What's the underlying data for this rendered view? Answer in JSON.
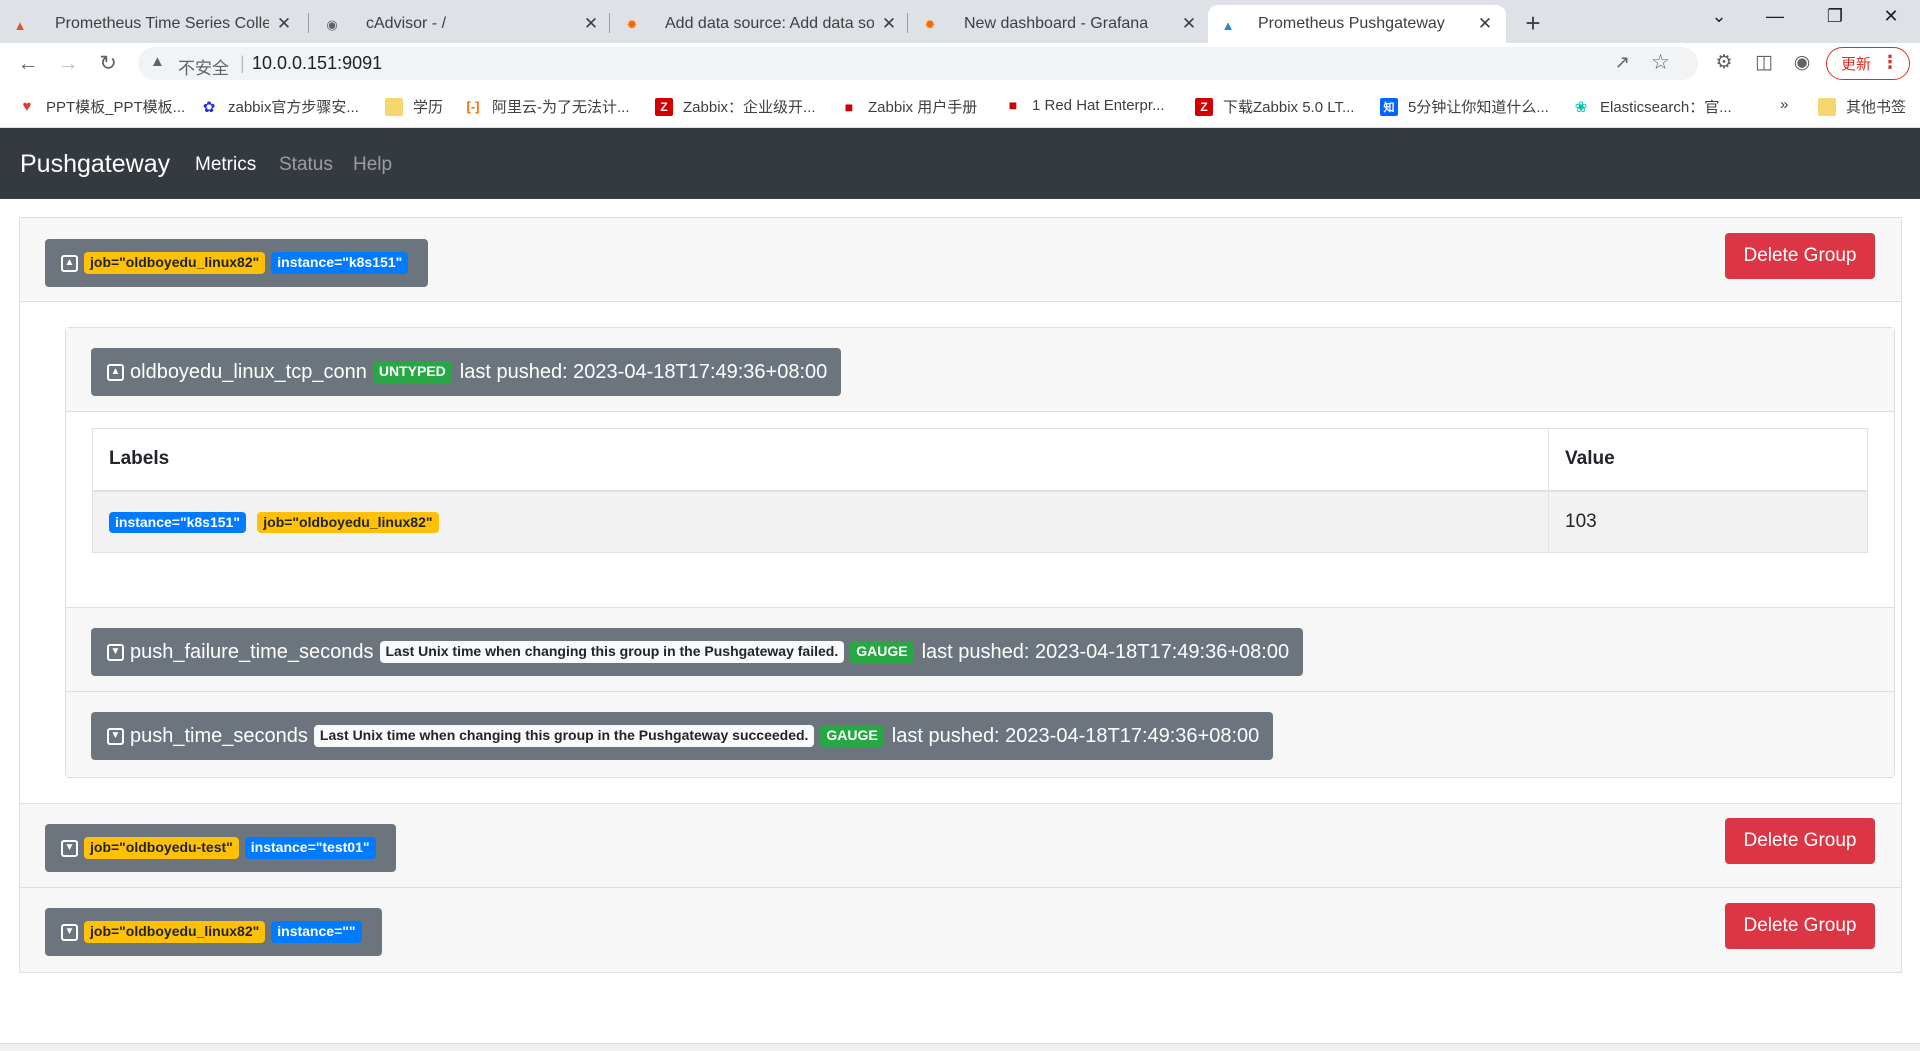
{
  "browser": {
    "tabs": [
      {
        "title": "Prometheus Time Series Collec"
      },
      {
        "title": "cAdvisor - /"
      },
      {
        "title": "Add data source: Add data so"
      },
      {
        "title": "New dashboard - Grafana"
      },
      {
        "title": "Prometheus Pushgateway"
      }
    ],
    "address": {
      "insecure_label": "不安全",
      "url": "10.0.0.151:9091"
    },
    "update_label": "更新",
    "bookmarks": [
      {
        "label": "PPT模板_PPT模板..."
      },
      {
        "label": "zabbix官方步骤安..."
      },
      {
        "label": "学历"
      },
      {
        "label": "阿里云-为了无法计..."
      },
      {
        "label": "Zabbix：企业级开..."
      },
      {
        "label": "Zabbix 用户手册"
      },
      {
        "label": "1 Red Hat Enterpr..."
      },
      {
        "label": "下载Zabbix 5.0 LT..."
      },
      {
        "label": "5分钟让你知道什么..."
      },
      {
        "label": "Elasticsearch：官..."
      }
    ],
    "other_bookmarks": "其他书签",
    "more_bookmarks": "»"
  },
  "navbar": {
    "brand": "Pushgateway",
    "links": [
      {
        "label": "Metrics"
      },
      {
        "label": "Status"
      },
      {
        "label": "Help"
      }
    ]
  },
  "groups": [
    {
      "labels": [
        {
          "text": "job=\"oldboyedu_linux82\""
        },
        {
          "text": "instance=\"k8s151\""
        }
      ],
      "delete_label": "Delete Group",
      "metrics": [
        {
          "name": "oldboyedu_linux_tcp_conn",
          "type": "UNTYPED",
          "last_pushed": "last pushed: 2023-04-18T17:49:36+08:00",
          "table": {
            "headers": {
              "labels": "Labels",
              "value": "Value"
            },
            "rows": [
              {
                "labels": [
                  {
                    "text": "instance=\"k8s151\""
                  },
                  {
                    "text": "job=\"oldboyedu_linux82\""
                  }
                ],
                "value": "103"
              }
            ]
          }
        },
        {
          "name": "push_failure_time_seconds",
          "help": "Last Unix time when changing this group in the Pushgateway failed.",
          "type": "GAUGE",
          "last_pushed": "last pushed: 2023-04-18T17:49:36+08:00"
        },
        {
          "name": "push_time_seconds",
          "help": "Last Unix time when changing this group in the Pushgateway succeeded.",
          "type": "GAUGE",
          "last_pushed": "last pushed: 2023-04-18T17:49:36+08:00"
        }
      ]
    },
    {
      "labels": [
        {
          "text": "job=\"oldboyedu-test\""
        },
        {
          "text": "instance=\"test01\""
        }
      ],
      "delete_label": "Delete Group"
    },
    {
      "labels": [
        {
          "text": "job=\"oldboyedu_linux82\""
        },
        {
          "text": "instance=\"\""
        }
      ],
      "delete_label": "Delete Group"
    }
  ],
  "colors": {
    "navbar": "#343a40",
    "danger": "#dc3545",
    "warning": "#ffc107",
    "primary": "#007bff",
    "success": "#28a745",
    "secondary": "#6c757d"
  }
}
